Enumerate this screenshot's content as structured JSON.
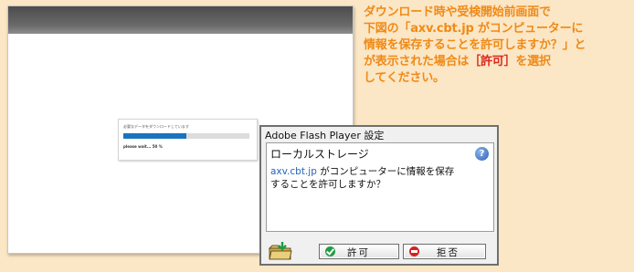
{
  "browser_page": {
    "loading_message": "必要なデータをダウンロードしています",
    "progress_percent": 50,
    "progress_text": "please wait... 50 %"
  },
  "instruction": {
    "line1": "ダウンロード時や受検開始前画面で",
    "line2": "下図の「axv.cbt.jp がコンピューターに",
    "line3": "情報を保存することを許可しますか？」と",
    "line4_pre": "が表示された場合は",
    "line4_highlight": "［許可］",
    "line4_post": "を選択",
    "line5": "してください。"
  },
  "flash_dialog": {
    "title": "Adobe Flash Player 設定",
    "heading": "ローカルストレージ",
    "help_icon": "help-icon",
    "domain": "axv.cbt.jp",
    "message_line1": " がコンピューターに情報を保存",
    "message_line2": "することを許可しますか？",
    "allow_label": "許可",
    "deny_label": "拒否"
  },
  "colors": {
    "background": "#fbe6c5",
    "instruction_text": "#f08a17",
    "highlight": "#d8281c",
    "domain_link": "#2565b7",
    "progress_fill": "#1b73c0"
  }
}
